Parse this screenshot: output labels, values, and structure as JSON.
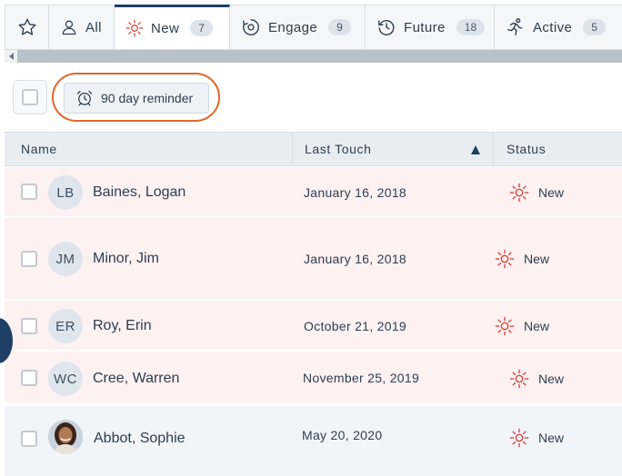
{
  "tabs": [
    {
      "id": "star",
      "label": ""
    },
    {
      "id": "all",
      "label": "All"
    },
    {
      "id": "new",
      "label": "New",
      "count": "7"
    },
    {
      "id": "engage",
      "label": "Engage",
      "count": "9"
    },
    {
      "id": "future",
      "label": "Future",
      "count": "18"
    },
    {
      "id": "active",
      "label": "Active",
      "count": "5"
    }
  ],
  "toolbar": {
    "reminder_label": "90 day reminder"
  },
  "table": {
    "headers": {
      "name": "Name",
      "last_touch": "Last Touch",
      "status": "Status"
    },
    "rows": [
      {
        "initials": "LB",
        "name": "Baines, Logan",
        "last_touch": "January 16, 2018",
        "status": "New"
      },
      {
        "initials": "JM",
        "name": "Minor, Jim",
        "last_touch": "January 16, 2018",
        "status": "New"
      },
      {
        "initials": "ER",
        "name": "Roy, Erin",
        "last_touch": "October 21, 2019",
        "status": "New"
      },
      {
        "initials": "WC",
        "name": "Cree, Warren",
        "last_touch": "November 25, 2019",
        "status": "New"
      },
      {
        "initials": "",
        "name": "Abbot, Sophie",
        "last_touch": "May 20, 2020",
        "status": "New"
      }
    ]
  },
  "colors": {
    "accent": "#1e3f66",
    "status_new": "#d9443c",
    "highlight": "#e0672a"
  }
}
